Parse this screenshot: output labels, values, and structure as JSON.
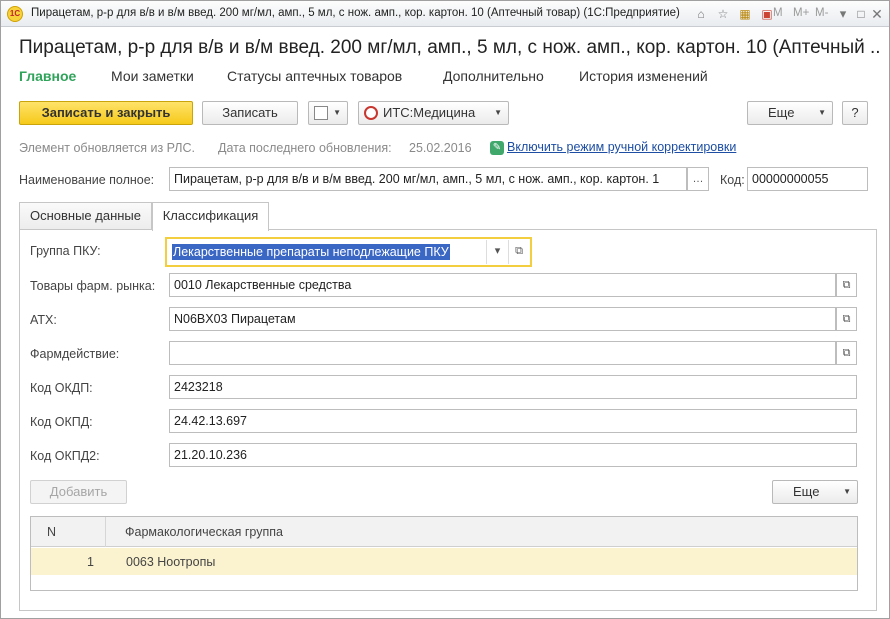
{
  "window": {
    "title": "Пирацетам, р-р для в/в и в/м введ. 200 мг/мл, амп., 5 мл, с нож. амп., кор. картон. 10 (Аптечный товар)  (1С:Предприятие)",
    "logo_text": "1С",
    "buttons": {
      "m": "M",
      "mplus": "M+",
      "mminus": "M-"
    }
  },
  "page": {
    "title": "Пирацетам, р-р для в/в и в/м введ. 200 мг/мл, амп., 5 мл, с нож. амп., кор. картон. 10 (Аптечный ...",
    "nav_tabs": [
      "Главное",
      "Мои заметки",
      "Статусы аптечных товаров",
      "Дополнительно",
      "История изменений"
    ]
  },
  "toolbar": {
    "save_close": "Записать и закрыть",
    "save": "Записать",
    "its": "ИТС:Медицина",
    "more": "Еще",
    "help": "?"
  },
  "info": {
    "rls_text": "Элемент обновляется из РЛС.",
    "last_update_label": "Дата последнего обновления:",
    "last_update_value": "25.02.2016",
    "manual_link": "Включить режим ручной корректировки"
  },
  "fullname": {
    "label": "Наименование полное:",
    "value": "Пирацетам, р-р для в/в и в/м введ. 200 мг/мл, амп., 5 мл, с нож. амп., кор. картон. 1",
    "code_label": "Код:",
    "code_value": "00000000055"
  },
  "content_tabs": [
    "Основные данные",
    "Классификация"
  ],
  "form": {
    "pku_label": "Группа ПКУ:",
    "pku_value": "Лекарственные препараты неподлежащие ПКУ",
    "market_label": "Товары фарм. рынка:",
    "market_value": "0010 Лекарственные средства",
    "atc_label": "АТХ:",
    "atc_value": "N06BX03 Пирацетам",
    "pharm_label": "Фармдействие:",
    "pharm_value": "",
    "okdp_label": "Код ОКДП:",
    "okdp_value": "2423218",
    "okpd_label": "Код ОКПД:",
    "okpd_value": "24.42.13.697",
    "okpd2_label": "Код ОКПД2:",
    "okpd2_value": "21.20.10.236"
  },
  "table_toolbar": {
    "add": "Добавить",
    "more": "Еще"
  },
  "table": {
    "columns": [
      "N",
      "Фармакологическая группа"
    ],
    "rows": [
      {
        "n": "1",
        "group": "0063 Ноотропы"
      }
    ]
  }
}
